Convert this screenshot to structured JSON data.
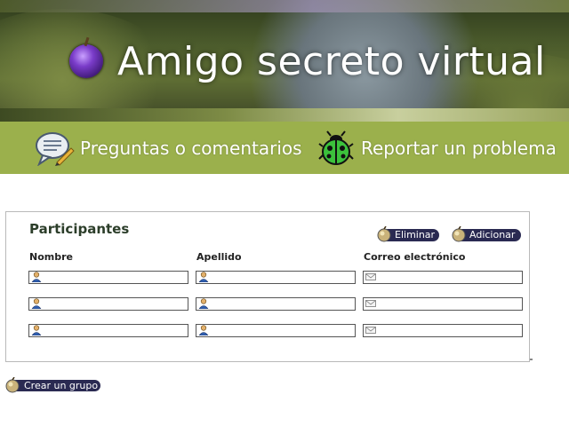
{
  "header": {
    "app_title": "Amigo secreto virtual",
    "logo_icon": "plum-icon"
  },
  "nav": {
    "items": [
      {
        "label": "Preguntas o comentarios",
        "icon": "chat-bubble-pencil-icon"
      },
      {
        "label": "Reportar un problema",
        "icon": "ladybug-icon"
      }
    ],
    "bar_color": "#9bb04c"
  },
  "participants": {
    "title": "Participantes",
    "delete_label": "Eliminar",
    "add_label": "Adicionar",
    "columns": [
      "Nombre",
      "Apellido",
      "Correo electrónico"
    ],
    "rows": [
      {
        "nombre": "",
        "apellido": "",
        "correo": ""
      },
      {
        "nombre": "",
        "apellido": "",
        "correo": ""
      },
      {
        "nombre": "",
        "apellido": "",
        "correo": ""
      }
    ]
  },
  "create_group_label": "Crear un grupo",
  "colors": {
    "button_bg": "#2a2a52",
    "title_color": "#2c3e2a"
  }
}
